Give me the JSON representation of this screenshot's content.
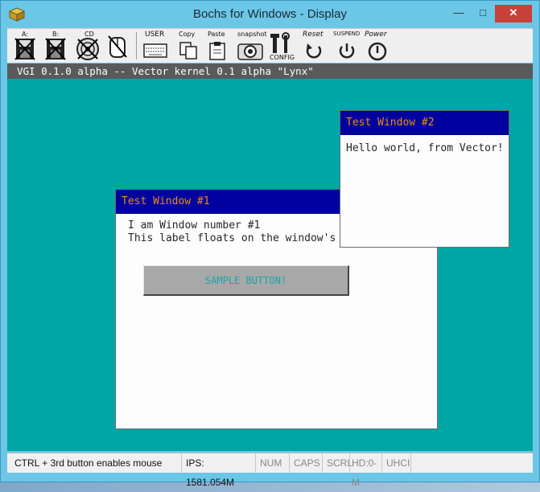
{
  "window": {
    "title": "Bochs for Windows - Display",
    "minimize": "—",
    "maximize": "□",
    "close": "✕"
  },
  "toolbar": {
    "items": [
      {
        "label": "A:",
        "icon": "floppy-a-icon"
      },
      {
        "label": "B:",
        "icon": "floppy-b-icon"
      },
      {
        "label": "CD",
        "icon": "cdrom-icon"
      },
      {
        "label": "",
        "icon": "mouse-icon"
      },
      {
        "label": "USER",
        "icon": "keyboard-icon"
      },
      {
        "label": "Copy",
        "icon": "copy-icon"
      },
      {
        "label": "Paste",
        "icon": "paste-icon"
      },
      {
        "label": "snapshot",
        "icon": "snapshot-icon"
      },
      {
        "label": "CONFIG",
        "icon": "config-icon"
      },
      {
        "label": "Reset",
        "icon": "reset-icon"
      },
      {
        "label": "SUSPEND",
        "icon": "suspend-icon"
      },
      {
        "label": "Power",
        "icon": "power-icon"
      }
    ]
  },
  "vgi_header": "VGI 0.1.0 alpha -- Vector kernel 0.1 alpha \"Lynx\"",
  "window1": {
    "title": "Test Window #1",
    "line1": "I am Window number #1",
    "line2": "This label floats on the window's",
    "button": "SAMPLE BUTTON!"
  },
  "window2": {
    "title": "Test Window #2",
    "text": "Hello world, from Vector!"
  },
  "status": {
    "hint": "CTRL + 3rd button enables mouse",
    "ips": "IPS: 1581.054M",
    "num": "NUM",
    "caps": "CAPS",
    "scrl": "SCRL",
    "hd": "HD:0-M",
    "uhci": "UHCI"
  },
  "colors": {
    "desktop": "#00a6a4",
    "window_title_bg": "#00009e",
    "window_title_fg": "#e98b18",
    "button_text": "#17a6a6"
  }
}
